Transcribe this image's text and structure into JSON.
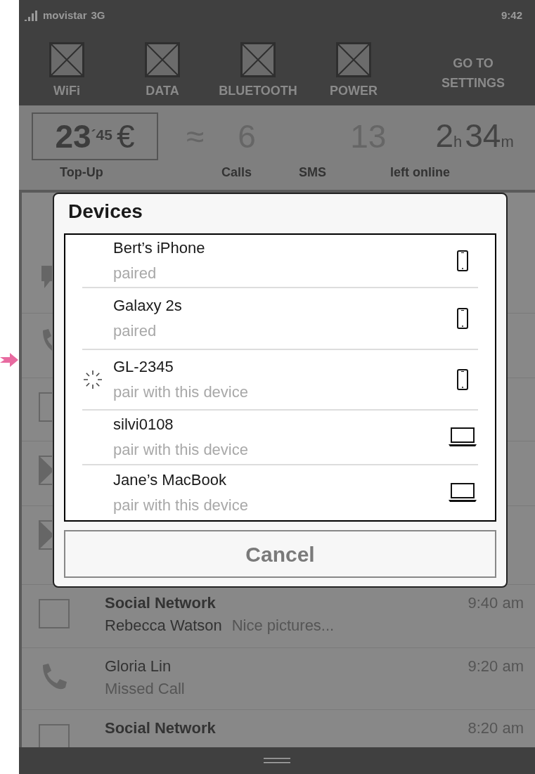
{
  "status_bar": {
    "carrier": "movistar",
    "network": "3G",
    "time": "9:42"
  },
  "toggles": [
    {
      "label": "WiFi"
    },
    {
      "label": "DATA"
    },
    {
      "label": "BLUETOOTH"
    },
    {
      "label": "POWER"
    }
  ],
  "settings_link": "GO TO SETTINGS",
  "balance": {
    "amount": "23",
    "cents": "´45",
    "currency": "€",
    "label": "Top-Up"
  },
  "approx": "≈",
  "stats": [
    {
      "value": "6",
      "label": "Calls"
    },
    {
      "value": "13",
      "label": "SMS"
    }
  ],
  "time_left": {
    "hours": "2",
    "hours_unit": "h",
    "minutes": "34",
    "minutes_unit": "m",
    "label": "left online"
  },
  "notifications": [
    {
      "kind": "chat"
    },
    {
      "kind": "call"
    },
    {
      "kind": "app"
    },
    {
      "kind": "mail"
    },
    {
      "kind": "mail"
    },
    {
      "kind": "app",
      "title": "Social Network",
      "sender": "Rebecca Watson",
      "text": "Nice pictures...",
      "time": "9:40 am"
    },
    {
      "kind": "call",
      "title": "Gloria Lin",
      "text": "Missed Call",
      "time": "9:20 am"
    },
    {
      "kind": "app",
      "title": "Social Network",
      "time": "8:20 am"
    }
  ],
  "dialog": {
    "title": "Devices",
    "devices": [
      {
        "name": "Bert’s iPhone",
        "status": "paired",
        "kind": "phone",
        "pairing": false
      },
      {
        "name": "Galaxy 2s",
        "status": "paired",
        "kind": "phone",
        "pairing": false
      },
      {
        "name": "GL-2345",
        "status": "pair with this device",
        "kind": "phone",
        "pairing": true
      },
      {
        "name": "silvi0108",
        "status": "pair with this device",
        "kind": "laptop",
        "pairing": false
      },
      {
        "name": "Jane’s MacBook",
        "status": "pair with this device",
        "kind": "laptop",
        "pairing": false
      }
    ],
    "cancel": "Cancel"
  }
}
